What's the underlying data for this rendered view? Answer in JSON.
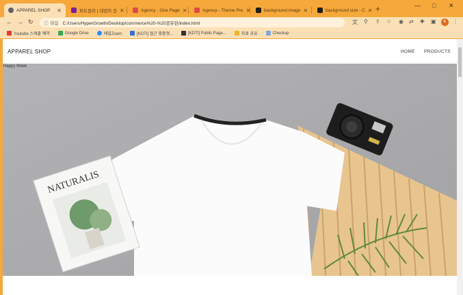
{
  "browser": {
    "tabs": [
      {
        "title": "APPAREL SHOP",
        "color": "#4a4a4a"
      },
      {
        "title": "파트원라 | 네임의 진",
        "color": "#7a1fa2"
      },
      {
        "title": "Agency - One Page",
        "color": "#e04848"
      },
      {
        "title": "Agency - Theme Pre",
        "color": "#e04848"
      },
      {
        "title": "background image",
        "color": "#1f1f1f"
      },
      {
        "title": "background size - C",
        "color": "#1f1f1f"
      }
    ],
    "new_tab": "+",
    "window_controls": {
      "minimize": "—",
      "maximize": "□",
      "close": "✕"
    },
    "address": {
      "security_label": "파일",
      "url": "C:/Users/HyperGrowth/Desktop/commerce%20-%20공유된/index.html"
    },
    "profile_initial": "K",
    "bookmarks": [
      {
        "label": "Youtube 스케줄 예약",
        "color": "#e53935"
      },
      {
        "label": "Google Drive",
        "color": "#34a853"
      },
      {
        "label": "패밀Zoom",
        "color": "#2d8cff"
      },
      {
        "label": "[KDTI] 접근 맞춤형...",
        "color": "#3b6fd4"
      },
      {
        "label": "[KDTI] Public Page...",
        "color": "#333333"
      },
      {
        "label": "자료 공유",
        "color": "#f0b429"
      },
      {
        "label": "Checkup",
        "color": "#7fa7d8"
      }
    ]
  },
  "site": {
    "logo": "APPAREL SHOP",
    "nav": [
      "HOME",
      "PRODUCTS"
    ],
    "hero_caption": "Happy Week"
  },
  "magazine": {
    "title": "NATURALIS"
  },
  "colors": {
    "tabstrip": "#f6a83b",
    "toolbar": "#fbe0b6",
    "hero_bg": "#a9a9ab"
  }
}
